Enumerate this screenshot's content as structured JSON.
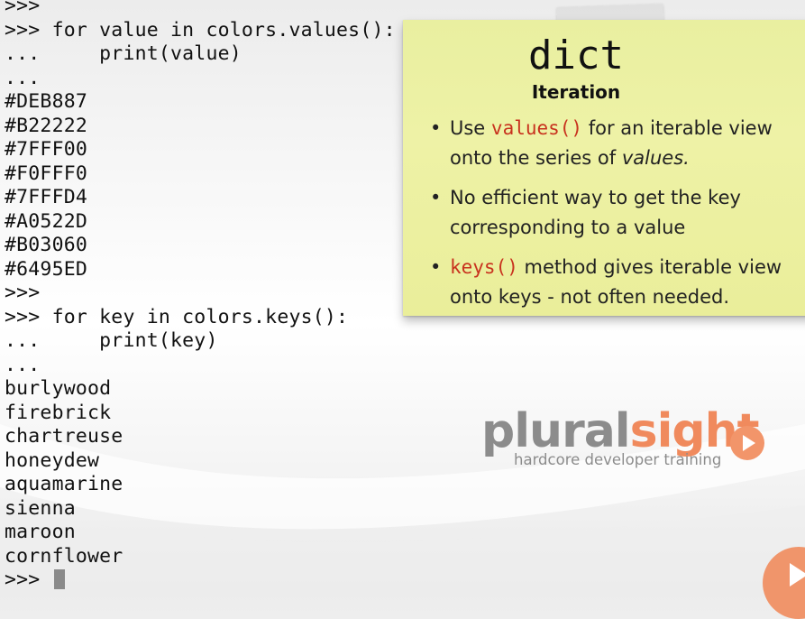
{
  "terminal": {
    "lines": [
      ">>>",
      ">>> for value in colors.values():",
      "...     print(value)",
      "...",
      "#DEB887",
      "#B22222",
      "#7FFF00",
      "#F0FFF0",
      "#7FFFD4",
      "#A0522D",
      "#B03060",
      "#6495ED",
      ">>>",
      ">>> for key in colors.keys():",
      "...     print(key)",
      "...",
      "burlywood",
      "firebrick",
      "chartreuse",
      "honeydew",
      "aquamarine",
      "sienna",
      "maroon",
      "cornflower"
    ],
    "prompt": ">>> "
  },
  "note": {
    "title": "dict",
    "subtitle": "Iteration",
    "bullet_char": "•",
    "bullets": {
      "b1_code": "values()",
      "b1_text_a": " for an iterable view onto the series of ",
      "b1_em": "values.",
      "b1_prefix": "Use ",
      "b2_text": "No efficient way to get the key corresponding to a value",
      "b3_code": "keys()",
      "b3_text": " method gives iterable view onto keys - not often needed."
    },
    "colors": {
      "background": "#eef2a6",
      "code": "#c8321e"
    }
  },
  "logo": {
    "word_main": "plural",
    "word_accent": "sight",
    "tagline": "hardcore developer training",
    "colors": {
      "gray": "#8c8c8c",
      "orange": "#f08a5d"
    }
  },
  "icons": {
    "play": "play-icon"
  }
}
